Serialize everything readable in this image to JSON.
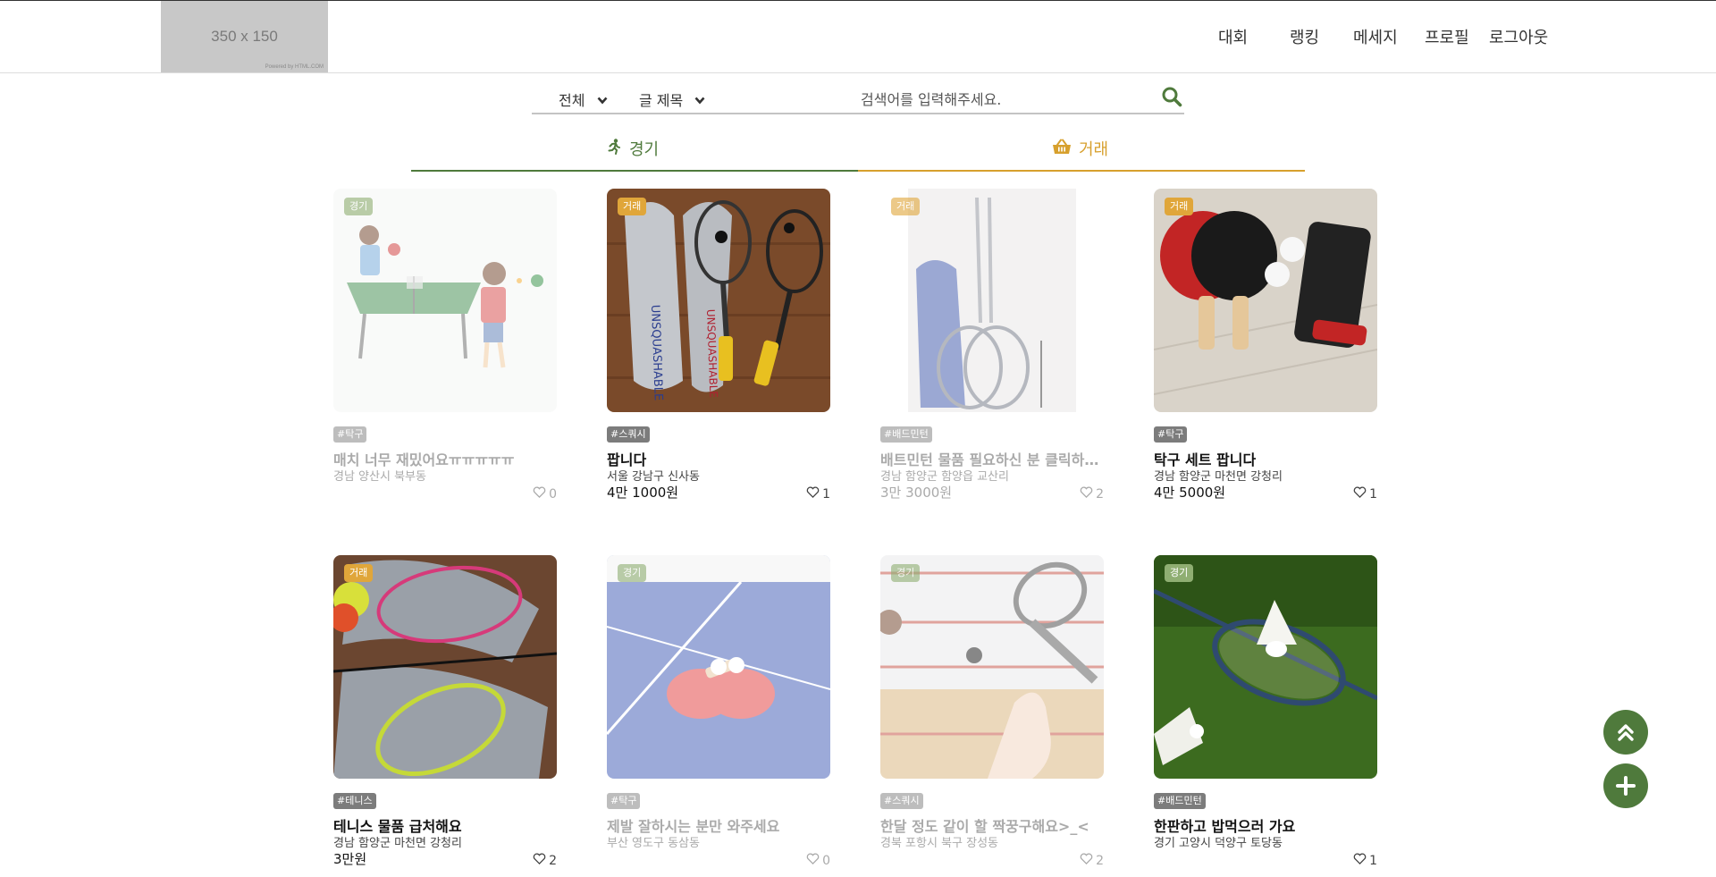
{
  "logo": {
    "text": "350 x 150",
    "sub": "Powered by HTML.COM"
  },
  "nav": {
    "items": [
      "대회",
      "랭킹",
      "메세지",
      "프로필",
      "로그아웃"
    ]
  },
  "search": {
    "category_value": "전체",
    "field_value": "글 제목",
    "placeholder": "검색어를 입력해주세요."
  },
  "tabs": [
    {
      "label": "경기",
      "icon": "running-person-icon",
      "color": "#4f7a3c"
    },
    {
      "label": "거래",
      "icon": "basket-icon",
      "color": "#d7a02d"
    }
  ],
  "colors": {
    "accent_green": "#4f7a3c",
    "accent_gold": "#d7a02d",
    "badge_game": "#8fae72",
    "badge_trade": "#e0a63a"
  },
  "posts": [
    {
      "badge": "경기",
      "tag": "#탁구",
      "title": "매치 너무 재밌어요ㅠㅠㅠㅠㅠ",
      "location": "경남 양산시 북부동",
      "price": "",
      "likes": "0",
      "dimmed": true
    },
    {
      "badge": "거래",
      "tag": "#스쿼시",
      "title": "팝니다",
      "location": "서울 강남구 신사동",
      "price": "4만 1000원",
      "likes": "1",
      "dimmed": false
    },
    {
      "badge": "거래",
      "tag": "#배드민턴",
      "title": "배트민턴 물품 필요하신 분 클릭하세요",
      "location": "경남 함양군 함양읍 교산리",
      "price": "3만 3000원",
      "likes": "2",
      "dimmed": true
    },
    {
      "badge": "거래",
      "tag": "#탁구",
      "title": "탁구 세트 팝니다",
      "location": "경남 함양군 마천면 강청리",
      "price": "4만 5000원",
      "likes": "1",
      "dimmed": false
    },
    {
      "badge": "거래",
      "tag": "#테니스",
      "title": "테니스 물품 급처해요",
      "location": "경남 함양군 마천면 강청리",
      "price": "3만원",
      "likes": "2",
      "dimmed": false
    },
    {
      "badge": "경기",
      "tag": "#탁구",
      "title": "제발 잘하시는 분만 와주세요",
      "location": "부산 영도구 동삼동",
      "price": "",
      "likes": "0",
      "dimmed": true
    },
    {
      "badge": "경기",
      "tag": "#스쿼시",
      "title": "한달 정도 같이 할 짝꿍구해요>_<",
      "location": "경북 포항시 북구 장성동",
      "price": "",
      "likes": "2",
      "dimmed": true
    },
    {
      "badge": "경기",
      "tag": "#배드민턴",
      "title": "한판하고 밥먹으러 가요",
      "location": "경기 고양시 덕양구 토당동",
      "price": "",
      "likes": "1",
      "dimmed": false
    }
  ]
}
